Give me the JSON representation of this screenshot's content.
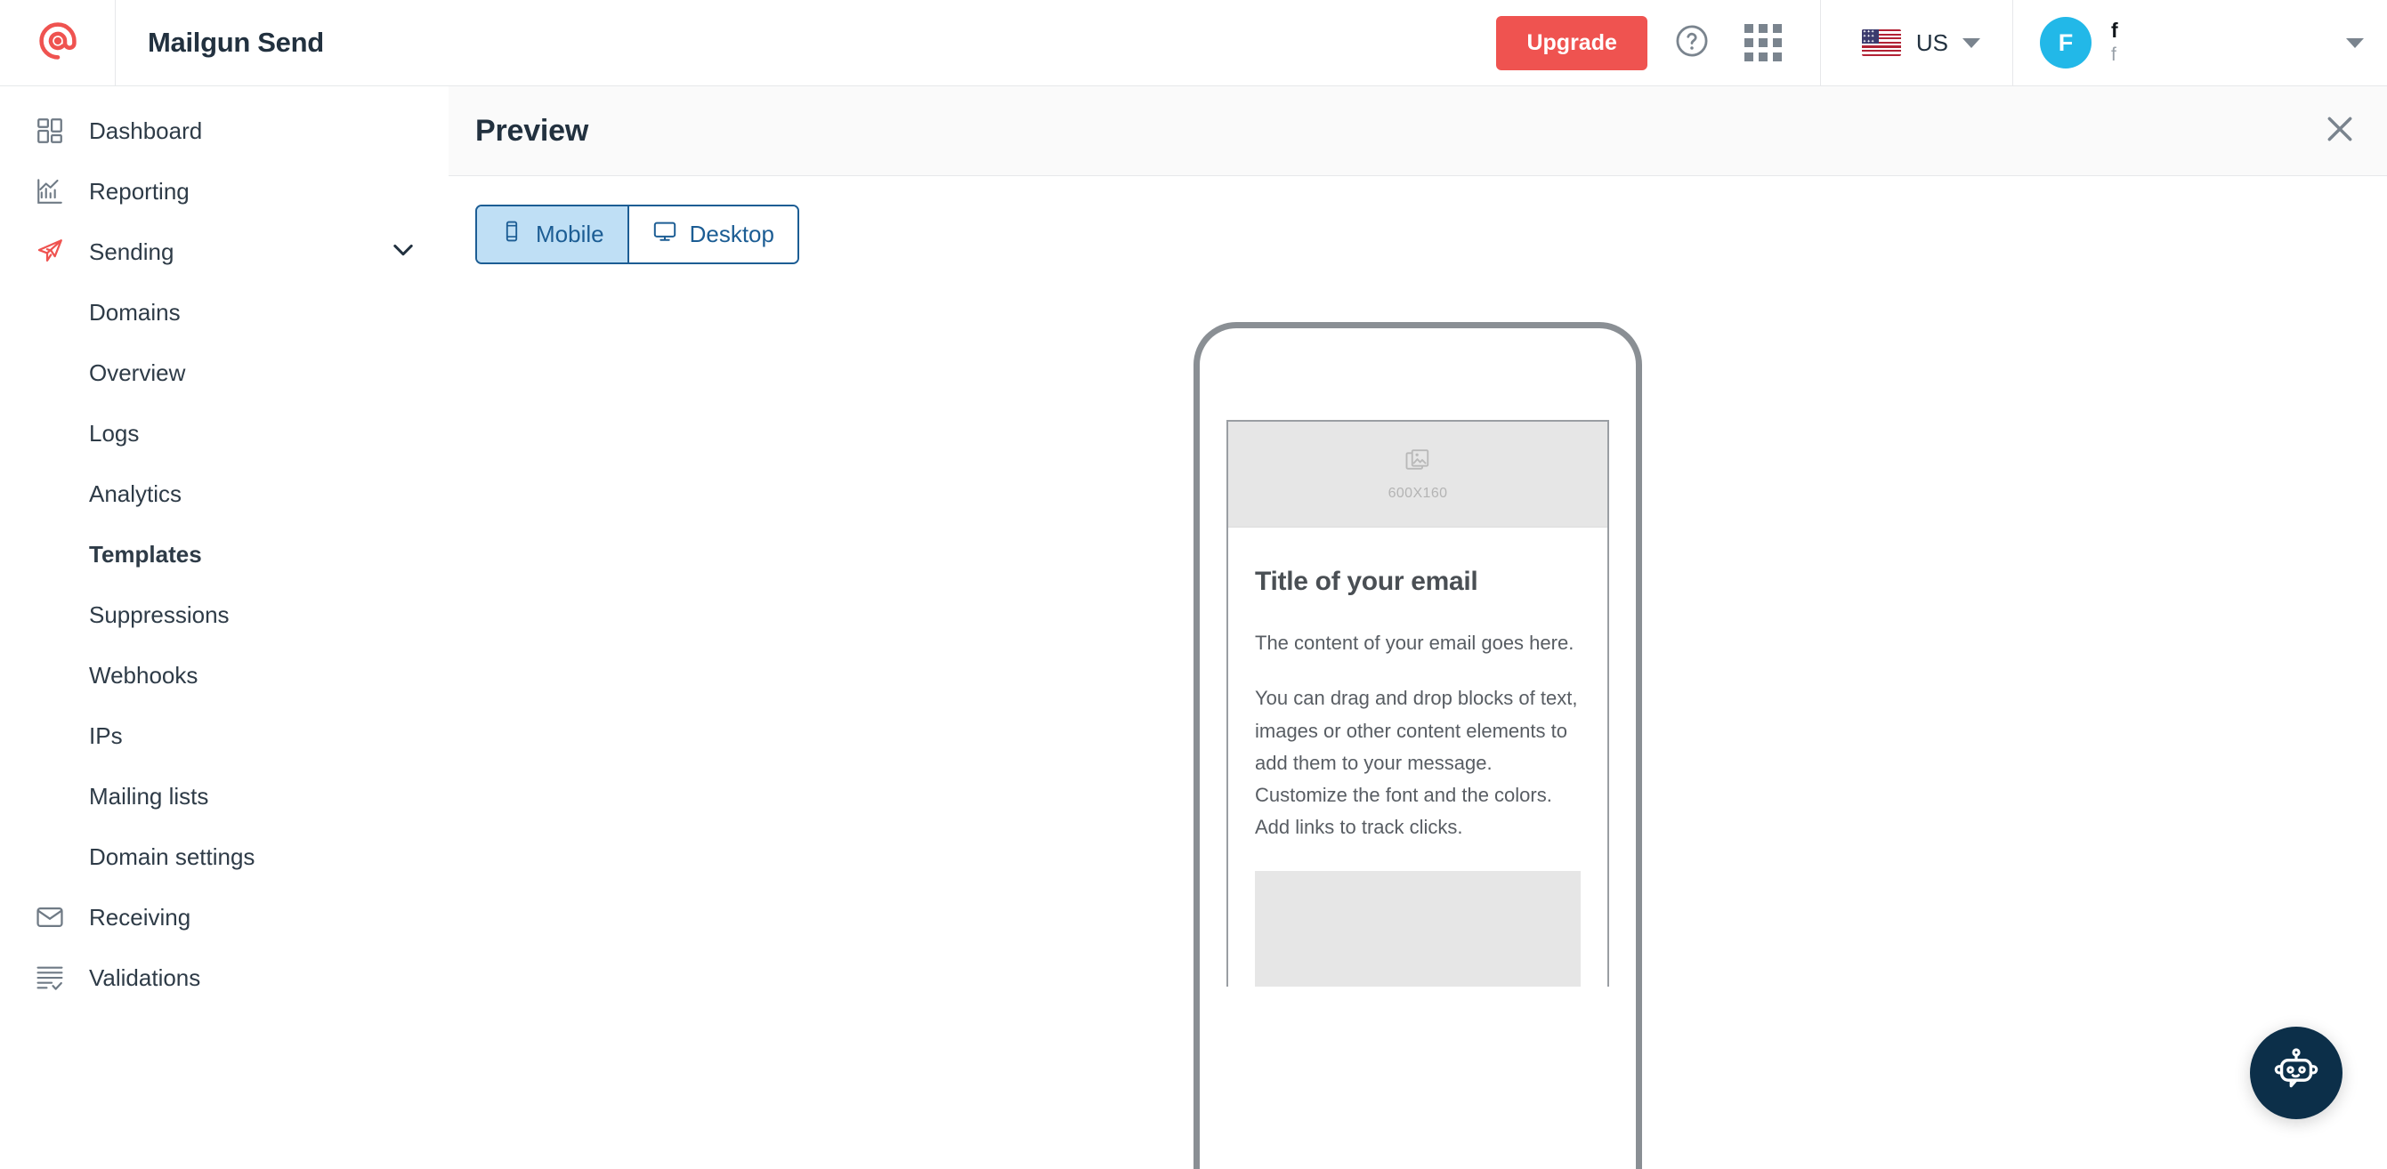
{
  "topbar": {
    "logo_icon": "mailgun-at-logo-icon",
    "brand_title": "Mailgun Send",
    "upgrade_label": "Upgrade",
    "help_icon": "help-circle-icon",
    "apps_icon": "apps-grid-icon",
    "locale_label": "US",
    "locale_flag_icon": "us-flag-icon",
    "locale_caret_icon": "caret-down-icon",
    "user": {
      "avatar_initial": "F",
      "name": "f",
      "subtitle": "f",
      "caret_icon": "caret-down-icon",
      "avatar_color": "#22b8e8"
    }
  },
  "sidebar": {
    "items": [
      {
        "label": "Dashboard",
        "icon": "dashboard-grid-icon",
        "level": "top",
        "active": false
      },
      {
        "label": "Reporting",
        "icon": "chart-bars-icon",
        "level": "top",
        "active": false
      },
      {
        "label": "Sending",
        "icon": "paper-plane-icon",
        "level": "top",
        "active": false,
        "expanded": true,
        "chevron_icon": "chevron-down-icon"
      },
      {
        "label": "Domains",
        "icon": "",
        "level": "sub",
        "active": false
      },
      {
        "label": "Overview",
        "icon": "",
        "level": "sub",
        "active": false
      },
      {
        "label": "Logs",
        "icon": "",
        "level": "sub",
        "active": false
      },
      {
        "label": "Analytics",
        "icon": "",
        "level": "sub",
        "active": false
      },
      {
        "label": "Templates",
        "icon": "",
        "level": "sub",
        "active": true
      },
      {
        "label": "Suppressions",
        "icon": "",
        "level": "sub",
        "active": false
      },
      {
        "label": "Webhooks",
        "icon": "",
        "level": "sub",
        "active": false
      },
      {
        "label": "IPs",
        "icon": "",
        "level": "sub",
        "active": false
      },
      {
        "label": "Mailing lists",
        "icon": "",
        "level": "sub",
        "active": false
      },
      {
        "label": "Domain settings",
        "icon": "",
        "level": "sub",
        "active": false
      },
      {
        "label": "Receiving",
        "icon": "envelope-icon",
        "level": "top",
        "active": false
      },
      {
        "label": "Validations",
        "icon": "list-check-icon",
        "level": "top",
        "active": false
      }
    ]
  },
  "preview": {
    "title": "Preview",
    "close_icon": "close-x-icon",
    "view_toggle": {
      "options": [
        {
          "label": "Mobile",
          "icon": "mobile-phone-icon",
          "selected": true
        },
        {
          "label": "Desktop",
          "icon": "desktop-monitor-icon",
          "selected": false
        }
      ],
      "accent_color": "#1c5d94",
      "selected_bg": "#bfdff5"
    },
    "email": {
      "hero_image_icon": "image-placeholder-icon",
      "hero_dimensions": "600X160",
      "title": "Title of your email",
      "paragraphs": [
        "The content of your email goes here.",
        "You can drag and drop blocks of text, images or other content elements to add them to your message. Customize the font and the colors. Add links to track clicks."
      ]
    }
  },
  "chat": {
    "icon": "robot-chat-icon",
    "background_color": "#0c2f49"
  }
}
